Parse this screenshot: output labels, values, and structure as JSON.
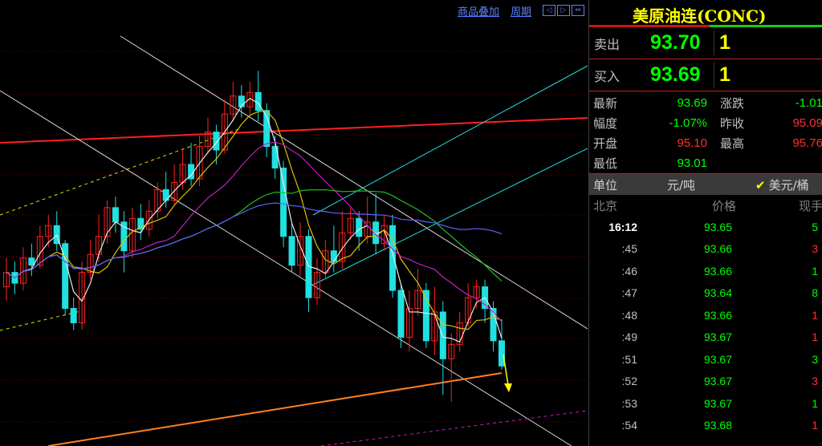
{
  "toolbar": {
    "overlay_label": "商品叠加",
    "period_label": "周期"
  },
  "quote": {
    "title": "美原油连(CONC)",
    "sell_label": "卖出",
    "sell_price": "93.70",
    "sell_qty": "1",
    "buy_label": "买入",
    "buy_price": "93.69",
    "buy_qty": "1",
    "stats": [
      {
        "k1": "最新",
        "v1": "93.69",
        "c1": "#00ff00",
        "k2": "涨跌",
        "v2": "-1.01",
        "c2": "#00ff00"
      },
      {
        "k1": "幅度",
        "v1": "-1.07%",
        "c1": "#00ff00",
        "k2": "昨收",
        "v2": "95.09",
        "c2": "#ff3030"
      },
      {
        "k1": "开盘",
        "v1": "95.10",
        "c1": "#ff3030",
        "k2": "最高",
        "v2": "95.76",
        "c2": "#ff3030"
      },
      {
        "k1": "最低",
        "v1": "93.01",
        "c1": "#00ff00",
        "k2": "",
        "v2": "",
        "c2": "#c0c0c0"
      }
    ],
    "unit_label": "单位",
    "unit_cny": "元/吨",
    "unit_usd": "美元/桶",
    "tick_head": {
      "time": "北京",
      "price": "价格",
      "vol": "现手"
    },
    "ticks": [
      {
        "t": "16:12",
        "p": "93.65",
        "v": "5",
        "vc": "#00ff00",
        "bold": true
      },
      {
        "t": ":45",
        "p": "93.66",
        "v": "3",
        "vc": "#ff3030",
        "bold": false
      },
      {
        "t": ":46",
        "p": "93.66",
        "v": "1",
        "vc": "#00ff00",
        "bold": false
      },
      {
        "t": ":47",
        "p": "93.64",
        "v": "8",
        "vc": "#00ff00",
        "bold": false
      },
      {
        "t": ":48",
        "p": "93.66",
        "v": "1",
        "vc": "#ff3030",
        "bold": false
      },
      {
        "t": ":49",
        "p": "93.67",
        "v": "1",
        "vc": "#ff3030",
        "bold": false
      },
      {
        "t": ":51",
        "p": "93.67",
        "v": "3",
        "vc": "#00ff00",
        "bold": false
      },
      {
        "t": ":52",
        "p": "93.67",
        "v": "3",
        "vc": "#ff3030",
        "bold": false
      },
      {
        "t": ":53",
        "p": "93.67",
        "v": "1",
        "vc": "#00ff00",
        "bold": false
      },
      {
        "t": ":54",
        "p": "93.68",
        "v": "1",
        "vc": "#ff3030",
        "bold": false
      }
    ]
  },
  "chart_data": {
    "type": "candlestick",
    "candles": [
      {
        "o": 94.2,
        "c": 94.6,
        "h": 95.0,
        "l": 93.8
      },
      {
        "o": 94.6,
        "c": 94.3,
        "h": 94.9,
        "l": 94.0
      },
      {
        "o": 94.3,
        "c": 95.0,
        "h": 95.3,
        "l": 94.1
      },
      {
        "o": 95.0,
        "c": 94.8,
        "h": 95.4,
        "l": 94.5
      },
      {
        "o": 94.8,
        "c": 95.6,
        "h": 95.9,
        "l": 94.7
      },
      {
        "o": 95.6,
        "c": 95.9,
        "h": 96.2,
        "l": 95.3
      },
      {
        "o": 95.9,
        "c": 95.4,
        "h": 96.3,
        "l": 95.2
      },
      {
        "o": 95.4,
        "c": 93.6,
        "h": 95.5,
        "l": 93.4
      },
      {
        "o": 93.6,
        "c": 93.2,
        "h": 93.9,
        "l": 93.0
      },
      {
        "o": 93.2,
        "c": 94.6,
        "h": 94.9,
        "l": 93.0
      },
      {
        "o": 94.6,
        "c": 95.1,
        "h": 95.5,
        "l": 94.4
      },
      {
        "o": 95.1,
        "c": 95.6,
        "h": 96.2,
        "l": 94.9
      },
      {
        "o": 95.6,
        "c": 96.4,
        "h": 96.6,
        "l": 95.4
      },
      {
        "o": 96.4,
        "c": 96.0,
        "h": 96.7,
        "l": 95.7
      },
      {
        "o": 96.0,
        "c": 95.2,
        "h": 96.3,
        "l": 94.6
      },
      {
        "o": 95.2,
        "c": 96.1,
        "h": 96.4,
        "l": 95.0
      },
      {
        "o": 96.1,
        "c": 95.8,
        "h": 96.5,
        "l": 95.5
      },
      {
        "o": 95.8,
        "c": 96.3,
        "h": 96.6,
        "l": 95.6
      },
      {
        "o": 96.3,
        "c": 96.9,
        "h": 97.1,
        "l": 96.1
      },
      {
        "o": 96.9,
        "c": 96.6,
        "h": 97.4,
        "l": 96.4
      },
      {
        "o": 96.6,
        "c": 97.1,
        "h": 97.6,
        "l": 96.5
      },
      {
        "o": 97.1,
        "c": 97.6,
        "h": 98.0,
        "l": 96.9
      },
      {
        "o": 97.6,
        "c": 97.2,
        "h": 98.2,
        "l": 97.0
      },
      {
        "o": 97.2,
        "c": 98.1,
        "h": 98.4,
        "l": 97.0
      },
      {
        "o": 98.1,
        "c": 98.5,
        "h": 98.9,
        "l": 97.9
      },
      {
        "o": 98.5,
        "c": 98.0,
        "h": 98.7,
        "l": 97.6
      },
      {
        "o": 98.0,
        "c": 99.0,
        "h": 99.4,
        "l": 97.9
      },
      {
        "o": 99.0,
        "c": 99.5,
        "h": 99.9,
        "l": 98.8
      },
      {
        "o": 99.5,
        "c": 99.2,
        "h": 99.8,
        "l": 98.9
      },
      {
        "o": 99.2,
        "c": 99.6,
        "h": 99.9,
        "l": 99.0
      },
      {
        "o": 99.6,
        "c": 99.1,
        "h": 100.2,
        "l": 98.8
      },
      {
        "o": 99.1,
        "c": 98.1,
        "h": 99.3,
        "l": 97.8
      },
      {
        "o": 98.1,
        "c": 97.5,
        "h": 98.4,
        "l": 97.2
      },
      {
        "o": 97.5,
        "c": 95.6,
        "h": 97.7,
        "l": 95.3
      },
      {
        "o": 95.6,
        "c": 94.8,
        "h": 96.0,
        "l": 94.6
      },
      {
        "o": 94.8,
        "c": 95.6,
        "h": 96.0,
        "l": 94.5
      },
      {
        "o": 95.6,
        "c": 93.9,
        "h": 95.8,
        "l": 93.5
      },
      {
        "o": 93.9,
        "c": 94.6,
        "h": 95.0,
        "l": 93.7
      },
      {
        "o": 94.6,
        "c": 95.2,
        "h": 95.5,
        "l": 94.4
      },
      {
        "o": 95.2,
        "c": 94.9,
        "h": 95.9,
        "l": 94.6
      },
      {
        "o": 94.9,
        "c": 95.7,
        "h": 96.3,
        "l": 94.7
      },
      {
        "o": 95.7,
        "c": 96.1,
        "h": 96.4,
        "l": 95.5
      },
      {
        "o": 96.1,
        "c": 95.6,
        "h": 96.3,
        "l": 95.2
      },
      {
        "o": 95.6,
        "c": 96.0,
        "h": 96.7,
        "l": 95.4
      },
      {
        "o": 96.0,
        "c": 95.4,
        "h": 96.8,
        "l": 95.1
      },
      {
        "o": 95.4,
        "c": 95.9,
        "h": 96.2,
        "l": 95.2
      },
      {
        "o": 95.9,
        "c": 94.1,
        "h": 96.2,
        "l": 93.9
      },
      {
        "o": 94.1,
        "c": 92.8,
        "h": 94.3,
        "l": 92.5
      },
      {
        "o": 92.8,
        "c": 93.6,
        "h": 94.1,
        "l": 92.4
      },
      {
        "o": 93.6,
        "c": 94.1,
        "h": 94.7,
        "l": 93.4
      },
      {
        "o": 94.1,
        "c": 92.7,
        "h": 94.3,
        "l": 92.5
      },
      {
        "o": 92.7,
        "c": 93.5,
        "h": 94.2,
        "l": 92.3
      },
      {
        "o": 93.5,
        "c": 92.2,
        "h": 93.8,
        "l": 91.2
      },
      {
        "o": 92.2,
        "c": 92.6,
        "h": 92.9,
        "l": 91.0
      },
      {
        "o": 92.6,
        "c": 93.2,
        "h": 93.5,
        "l": 92.4
      },
      {
        "o": 93.2,
        "c": 93.9,
        "h": 94.3,
        "l": 93.1
      },
      {
        "o": 93.9,
        "c": 94.2,
        "h": 94.4,
        "l": 93.6
      },
      {
        "o": 94.2,
        "c": 93.6,
        "h": 94.4,
        "l": 93.2
      },
      {
        "o": 93.6,
        "c": 92.7,
        "h": 93.8,
        "l": 92.4
      },
      {
        "o": 92.7,
        "c": 92.0,
        "h": 93.3,
        "l": 91.9
      }
    ],
    "y_range": [
      90.0,
      101.5
    ]
  }
}
